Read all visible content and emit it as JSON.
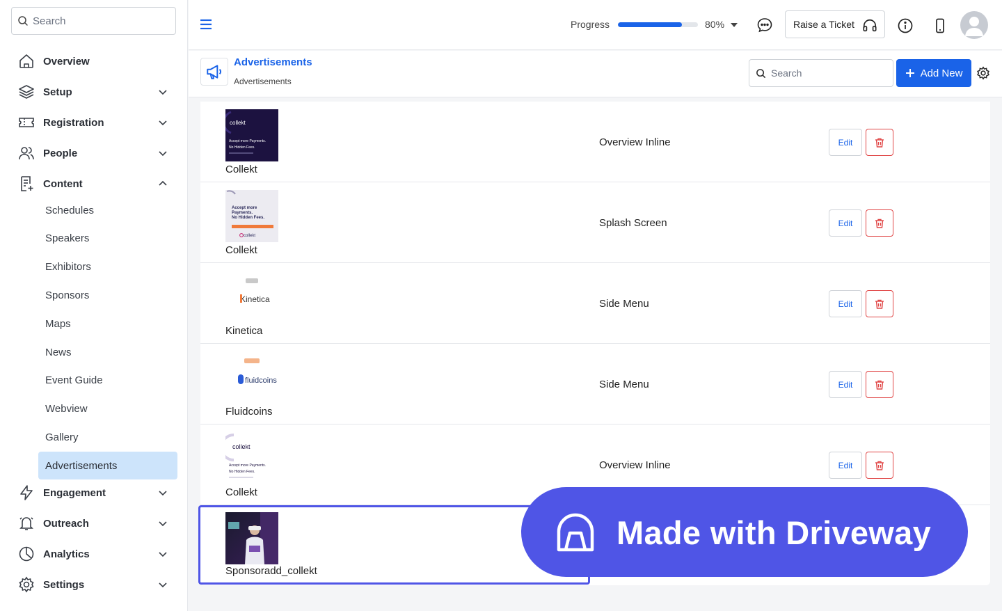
{
  "sidebar": {
    "search_placeholder": "Search",
    "items": [
      {
        "label": "Overview"
      },
      {
        "label": "Setup"
      },
      {
        "label": "Registration"
      },
      {
        "label": "People"
      },
      {
        "label": "Content"
      },
      {
        "label": "Engagement"
      },
      {
        "label": "Outreach"
      },
      {
        "label": "Analytics"
      },
      {
        "label": "Settings"
      }
    ],
    "content_sub": [
      {
        "label": "Schedules"
      },
      {
        "label": "Speakers"
      },
      {
        "label": "Exhibitors"
      },
      {
        "label": "Sponsors"
      },
      {
        "label": "Maps"
      },
      {
        "label": "News"
      },
      {
        "label": "Event Guide"
      },
      {
        "label": "Webview"
      },
      {
        "label": "Gallery"
      },
      {
        "label": "Advertisements"
      }
    ]
  },
  "topbar": {
    "progress_label": "Progress",
    "progress_value": 80,
    "progress_text": "80%",
    "ticket_label": "Raise a Ticket"
  },
  "page": {
    "title": "Advertisements",
    "breadcrumb": "Advertisements",
    "search_placeholder": "Search",
    "add_label": "Add New"
  },
  "rows": [
    {
      "name": "Collekt",
      "position": "Overview Inline",
      "edit": "Edit"
    },
    {
      "name": "Collekt",
      "position": "Splash Screen",
      "edit": "Edit"
    },
    {
      "name": "Kinetica",
      "position": "Side Menu",
      "edit": "Edit"
    },
    {
      "name": "Fluidcoins",
      "position": "Side Menu",
      "edit": "Edit"
    },
    {
      "name": "Collekt",
      "position": "Overview Inline",
      "edit": "Edit"
    },
    {
      "name": "Sponsoradd_collekt"
    }
  ],
  "thumbs": {
    "collekt_dark": {
      "brand": "collekt",
      "line1": "Accept more Payments.",
      "line2": "No Hidden Fees."
    },
    "collekt_light": {
      "line1": "Accept more",
      "line2": "Payments.",
      "line3": "No Hidden Fees.",
      "brand": "collekt"
    },
    "kinetica": {
      "brand": "Kinetica"
    },
    "fluidcoins": {
      "brand": "fluidcoins"
    },
    "collekt_white": {
      "brand": "collekt",
      "line1": "Accept more Payments.",
      "line2": "No Hidden Fees."
    }
  },
  "badge": {
    "text": "Made with Driveway"
  },
  "colors": {
    "accent": "#1a63e8",
    "danger": "#e04646",
    "active_bg": "#cde4fb",
    "badge": "#4f55e6"
  }
}
